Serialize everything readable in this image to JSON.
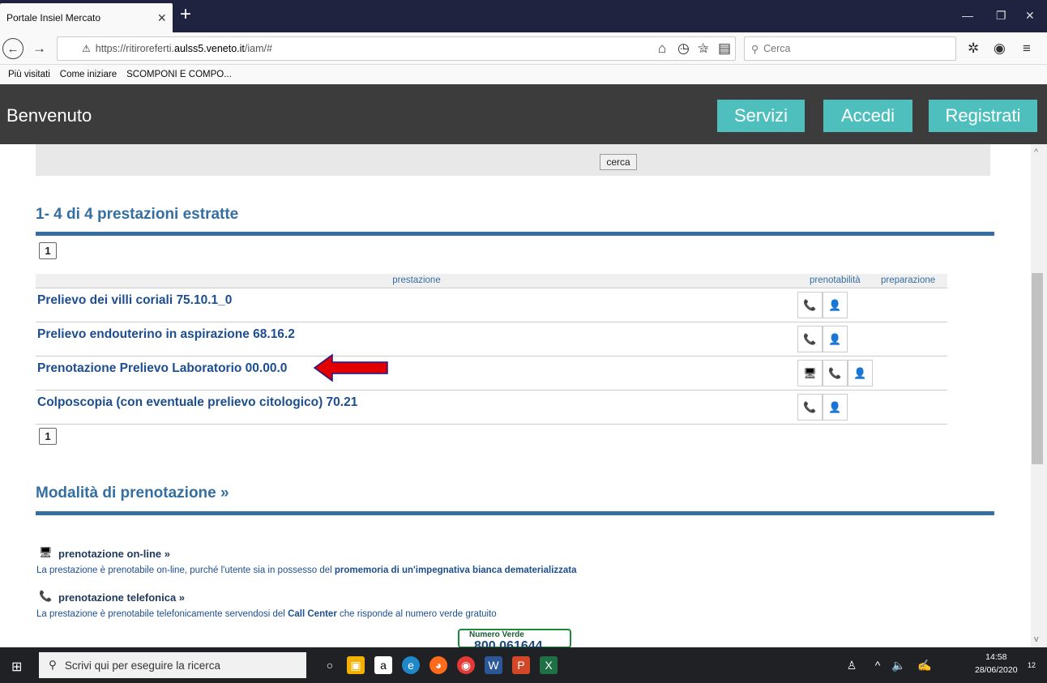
{
  "browser": {
    "tab_title": "Portale Insiel Mercato",
    "url_prefix": "https://ritiroreferti.",
    "url_domain": "aulss5.veneto.it",
    "url_path": "/iam/#",
    "search_placeholder": "Cerca",
    "bookmarks": [
      "Più visitati",
      "Come iniziare",
      "SCOMPONI E COMPO..."
    ]
  },
  "header": {
    "welcome": "Benvenuto",
    "buttons": [
      "Servizi",
      "Accedi",
      "Registrati"
    ]
  },
  "search_panel": {
    "button": "cerca"
  },
  "results": {
    "heading": "1- 4 di 4 prestazioni estratte",
    "page": "1",
    "columns": [
      "prestazione",
      "prenotabilità",
      "preparazione"
    ],
    "rows": [
      {
        "name": "Prelievo dei villi coriali 75.10.1_0",
        "icons": [
          "telephone-booking-icon",
          "person-booking-icon"
        ]
      },
      {
        "name": "Prelievo endouterino in aspirazione 68.16.2",
        "icons": [
          "telephone-booking-icon",
          "person-booking-icon"
        ]
      },
      {
        "name": "Prenotazione Prelievo Laboratorio 00.00.0",
        "icons": [
          "online-booking-icon",
          "telephone-booking-icon",
          "person-booking-icon"
        ]
      },
      {
        "name": "Colposcopia (con eventuale prelievo citologico) 70.21",
        "icons": [
          "telephone-booking-icon",
          "person-booking-icon"
        ]
      }
    ]
  },
  "modalita": {
    "heading": "Modalità di prenotazione »",
    "online_title": "prenotazione on-line »",
    "online_desc": "La prestazione è prenotabile on-line, purché l'utente sia in possesso del",
    "online_desc_bold": "promemoria di un'impegnativa bianca dematerializzata",
    "phone_title": "prenotazione telefonica »",
    "phone_desc": "La prestazione è prenotabile telefonicamente servendosi del",
    "phone_desc_bold": "Call Center",
    "phone_desc_end": "che risponde al numero verde gratuito",
    "numero_verde_label": "Numero Verde",
    "numero_verde": "800 061644"
  },
  "taskbar": {
    "search_placeholder": "Scrivi qui per eseguire la ricerca",
    "time": "14:58",
    "date": "28/06/2020",
    "notifications": "12"
  },
  "colors": {
    "accent": "#4fbfbe",
    "header_bg": "#3c3c3c",
    "link": "#1d4e91",
    "heading": "#356ea1",
    "arrow": "#e00000"
  }
}
